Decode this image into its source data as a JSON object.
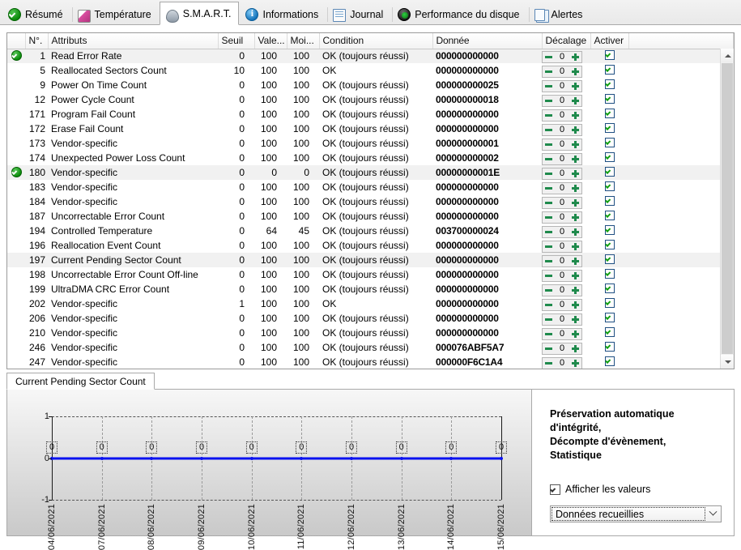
{
  "tabs": [
    {
      "label": "Résumé",
      "icon": "summary-check-icon",
      "active": false
    },
    {
      "label": "Température",
      "icon": "thermometer-icon",
      "active": false
    },
    {
      "label": "S.M.A.R.T.",
      "icon": "smart-disk-icon",
      "active": true
    },
    {
      "label": "Informations",
      "icon": "info-icon",
      "active": false
    },
    {
      "label": "Journal",
      "icon": "document-icon",
      "active": false
    },
    {
      "label": "Performance du disque",
      "icon": "gauge-icon",
      "active": false
    },
    {
      "label": "Alertes",
      "icon": "copy-pages-icon",
      "active": false
    }
  ],
  "table": {
    "columns": [
      "N°.",
      "Attributs",
      "Seuil",
      "Vale...",
      "Moi...",
      "Condition",
      "Donnée",
      "Décalage",
      "Activer"
    ],
    "rows": [
      {
        "status": "ok",
        "selected": true,
        "id": "1",
        "attribute": "Read Error Rate",
        "seuil": "0",
        "valeur": "100",
        "moindre": "100",
        "condition": "OK (toujours réussi)",
        "donnee": "000000000000",
        "decalage": "0",
        "activer": true
      },
      {
        "status": "",
        "selected": false,
        "id": "5",
        "attribute": "Reallocated Sectors Count",
        "seuil": "10",
        "valeur": "100",
        "moindre": "100",
        "condition": "OK",
        "donnee": "000000000000",
        "decalage": "0",
        "activer": true
      },
      {
        "status": "",
        "selected": false,
        "id": "9",
        "attribute": "Power On Time Count",
        "seuil": "0",
        "valeur": "100",
        "moindre": "100",
        "condition": "OK (toujours réussi)",
        "donnee": "000000000025",
        "decalage": "0",
        "activer": true
      },
      {
        "status": "",
        "selected": false,
        "id": "12",
        "attribute": "Power Cycle Count",
        "seuil": "0",
        "valeur": "100",
        "moindre": "100",
        "condition": "OK (toujours réussi)",
        "donnee": "000000000018",
        "decalage": "0",
        "activer": true
      },
      {
        "status": "",
        "selected": false,
        "id": "171",
        "attribute": "Program Fail Count",
        "seuil": "0",
        "valeur": "100",
        "moindre": "100",
        "condition": "OK (toujours réussi)",
        "donnee": "000000000000",
        "decalage": "0",
        "activer": true
      },
      {
        "status": "",
        "selected": false,
        "id": "172",
        "attribute": "Erase Fail Count",
        "seuil": "0",
        "valeur": "100",
        "moindre": "100",
        "condition": "OK (toujours réussi)",
        "donnee": "000000000000",
        "decalage": "0",
        "activer": true
      },
      {
        "status": "",
        "selected": false,
        "id": "173",
        "attribute": "Vendor-specific",
        "seuil": "0",
        "valeur": "100",
        "moindre": "100",
        "condition": "OK (toujours réussi)",
        "donnee": "000000000001",
        "decalage": "0",
        "activer": true
      },
      {
        "status": "",
        "selected": false,
        "id": "174",
        "attribute": "Unexpected Power Loss Count",
        "seuil": "0",
        "valeur": "100",
        "moindre": "100",
        "condition": "OK (toujours réussi)",
        "donnee": "000000000002",
        "decalage": "0",
        "activer": true
      },
      {
        "status": "ok",
        "selected": true,
        "id": "180",
        "attribute": "Vendor-specific",
        "seuil": "0",
        "valeur": "0",
        "moindre": "0",
        "condition": "OK (toujours réussi)",
        "donnee": "00000000001E",
        "decalage": "0",
        "activer": true
      },
      {
        "status": "",
        "selected": false,
        "id": "183",
        "attribute": "Vendor-specific",
        "seuil": "0",
        "valeur": "100",
        "moindre": "100",
        "condition": "OK (toujours réussi)",
        "donnee": "000000000000",
        "decalage": "0",
        "activer": true
      },
      {
        "status": "",
        "selected": false,
        "id": "184",
        "attribute": "Vendor-specific",
        "seuil": "0",
        "valeur": "100",
        "moindre": "100",
        "condition": "OK (toujours réussi)",
        "donnee": "000000000000",
        "decalage": "0",
        "activer": true
      },
      {
        "status": "",
        "selected": false,
        "id": "187",
        "attribute": "Uncorrectable Error Count",
        "seuil": "0",
        "valeur": "100",
        "moindre": "100",
        "condition": "OK (toujours réussi)",
        "donnee": "000000000000",
        "decalage": "0",
        "activer": true
      },
      {
        "status": "",
        "selected": false,
        "id": "194",
        "attribute": "Controlled Temperature",
        "seuil": "0",
        "valeur": "64",
        "moindre": "45",
        "condition": "OK (toujours réussi)",
        "donnee": "003700000024",
        "decalage": "0",
        "activer": true
      },
      {
        "status": "",
        "selected": false,
        "id": "196",
        "attribute": "Reallocation Event Count",
        "seuil": "0",
        "valeur": "100",
        "moindre": "100",
        "condition": "OK (toujours réussi)",
        "donnee": "000000000000",
        "decalage": "0",
        "activer": true
      },
      {
        "status": "",
        "selected": true,
        "id": "197",
        "attribute": "Current Pending Sector Count",
        "seuil": "0",
        "valeur": "100",
        "moindre": "100",
        "condition": "OK (toujours réussi)",
        "donnee": "000000000000",
        "decalage": "0",
        "activer": true
      },
      {
        "status": "",
        "selected": false,
        "id": "198",
        "attribute": "Uncorrectable Error Count Off-line",
        "seuil": "0",
        "valeur": "100",
        "moindre": "100",
        "condition": "OK (toujours réussi)",
        "donnee": "000000000000",
        "decalage": "0",
        "activer": true
      },
      {
        "status": "",
        "selected": false,
        "id": "199",
        "attribute": "UltraDMA CRC Error Count",
        "seuil": "0",
        "valeur": "100",
        "moindre": "100",
        "condition": "OK (toujours réussi)",
        "donnee": "000000000000",
        "decalage": "0",
        "activer": true
      },
      {
        "status": "",
        "selected": false,
        "id": "202",
        "attribute": "Vendor-specific",
        "seuil": "1",
        "valeur": "100",
        "moindre": "100",
        "condition": "OK",
        "donnee": "000000000000",
        "decalage": "0",
        "activer": true
      },
      {
        "status": "",
        "selected": false,
        "id": "206",
        "attribute": "Vendor-specific",
        "seuil": "0",
        "valeur": "100",
        "moindre": "100",
        "condition": "OK (toujours réussi)",
        "donnee": "000000000000",
        "decalage": "0",
        "activer": true
      },
      {
        "status": "",
        "selected": false,
        "id": "210",
        "attribute": "Vendor-specific",
        "seuil": "0",
        "valeur": "100",
        "moindre": "100",
        "condition": "OK (toujours réussi)",
        "donnee": "000000000000",
        "decalage": "0",
        "activer": true
      },
      {
        "status": "",
        "selected": false,
        "id": "246",
        "attribute": "Vendor-specific",
        "seuil": "0",
        "valeur": "100",
        "moindre": "100",
        "condition": "OK (toujours réussi)",
        "donnee": "000076ABF5A7",
        "decalage": "0",
        "activer": true
      },
      {
        "status": "",
        "selected": false,
        "id": "247",
        "attribute": "Vendor-specific",
        "seuil": "0",
        "valeur": "100",
        "moindre": "100",
        "condition": "OK (toujours réussi)",
        "donnee": "000000F6C1A4",
        "decalage": "0",
        "activer": true
      }
    ]
  },
  "bottom": {
    "tab_label": "Current Pending Sector Count",
    "side_title_line1": "Préservation automatique d'intégrité,",
    "side_title_line2": "Décompte d'évènement, Statistique",
    "show_values_label": "Afficher les valeurs",
    "show_values_checked": true,
    "combo_value": "Données recueillies"
  },
  "chart_data": {
    "type": "line",
    "title": "Current Pending Sector Count",
    "xlabel": "",
    "ylabel": "",
    "ylim": [
      -1,
      1
    ],
    "yticks": [
      1,
      0,
      -1
    ],
    "grid": true,
    "legend": null,
    "series_color": "#0b12f0",
    "categories": [
      "04/06/2021",
      "07/06/2021",
      "08/06/2021",
      "09/06/2021",
      "10/06/2021",
      "11/06/2021",
      "12/06/2021",
      "13/06/2021",
      "14/06/2021",
      "15/06/2021"
    ],
    "values": [
      0,
      0,
      0,
      0,
      0,
      0,
      0,
      0,
      0,
      0
    ],
    "point_labels": [
      "0",
      "0",
      "0",
      "0",
      "0",
      "0",
      "0",
      "0",
      "0",
      "0"
    ]
  }
}
